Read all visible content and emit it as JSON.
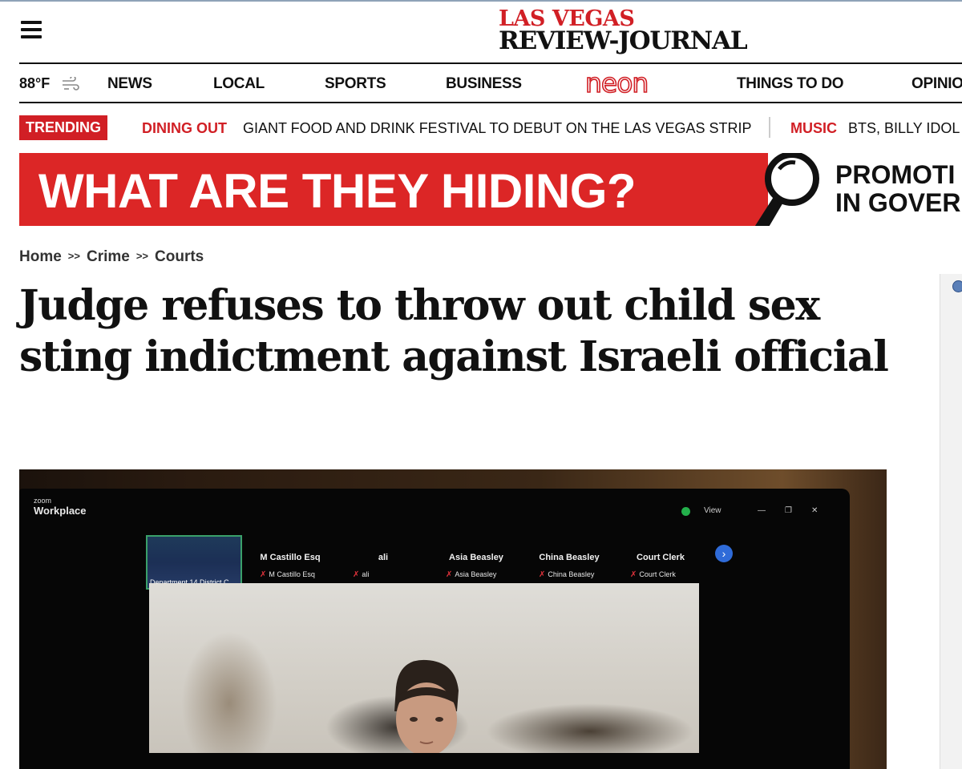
{
  "header": {
    "logo_line1": "LAS VEGAS",
    "logo_line2": "REVIEW-JOURNAL",
    "menu_icon": "hamburger-menu-icon"
  },
  "nav": {
    "temperature": "88°F",
    "weather_icon": "wind-icon",
    "items": [
      "NEWS",
      "LOCAL",
      "SPORTS",
      "BUSINESS",
      "neon",
      "THINGS TO DO",
      "OPINIO"
    ]
  },
  "trending": {
    "badge": "TRENDING",
    "stories": [
      {
        "category": "DINING OUT",
        "headline": "GIANT FOOD AND DRINK FESTIVAL TO DEBUT ON THE LAS VEGAS STRIP"
      },
      {
        "category": "MUSIC",
        "headline": "BTS, BILLY IDOL S"
      }
    ]
  },
  "ad": {
    "headline": "WHAT ARE THEY HIDING?",
    "promo_line1": "PROMOTI",
    "promo_line2": "IN GOVER"
  },
  "breadcrumb": [
    "Home",
    "Crime",
    "Courts"
  ],
  "breadcrumb_separator": ">>",
  "article": {
    "headline": "Judge refuses to throw out child sex sting indictment against Israeli official"
  },
  "photo": {
    "app_small": "zoom",
    "app_name": "Workplace",
    "view_label": "View",
    "thumb_label": "Department 14 District C",
    "participants": [
      {
        "name": "M Castillo Esq",
        "sub": "M Castillo Esq"
      },
      {
        "name": "ali",
        "sub": "ali"
      },
      {
        "name": "Asia Beasley",
        "sub": "Asia Beasley"
      },
      {
        "name": "China Beasley",
        "sub": "China Beasley"
      },
      {
        "name": "Court Clerk",
        "sub": "Court Clerk"
      }
    ]
  },
  "colors": {
    "brand_red": "#d11f25",
    "ad_red": "#dc2626",
    "text": "#111111"
  }
}
